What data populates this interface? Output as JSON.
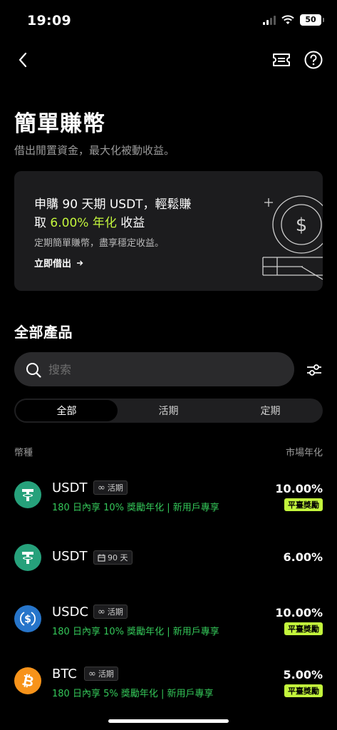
{
  "status": {
    "time": "19:09",
    "battery": "50"
  },
  "page": {
    "title": "簡單賺幣",
    "subtitle": "借出閒置資金，最大化被動收益。"
  },
  "promo": {
    "line1": "申購 90 天期 USDT，輕鬆賺",
    "line2_prefix": "取 ",
    "line2_accent": "6.00% 年化",
    "line2_suffix": " 收益",
    "desc": "定期簡單賺幣，盡享穩定收益。",
    "link": "立即借出",
    "accent_color": "#c3f53c"
  },
  "section": {
    "title": "全部產品"
  },
  "search": {
    "placeholder": "搜索",
    "value": ""
  },
  "tabs": [
    {
      "label": "全部",
      "active": true
    },
    {
      "label": "活期",
      "active": false
    },
    {
      "label": "定期",
      "active": false
    }
  ],
  "columns": {
    "left": "幣種",
    "right": "市場年化"
  },
  "products": [
    {
      "coin": "USDT",
      "icon": "tether-icon",
      "icon_color": "#26a17b",
      "term_icon": "infinity-icon",
      "term": "活期",
      "promo": "180 日內享 10% 獎勵年化 | 新用戶專享",
      "rate": "10.00%",
      "badge": "平臺獎勵"
    },
    {
      "coin": "USDT",
      "icon": "tether-icon",
      "icon_color": "#26a17b",
      "term_icon": "calendar-icon",
      "term": "90 天",
      "promo": "",
      "rate": "6.00%",
      "badge": ""
    },
    {
      "coin": "USDC",
      "icon": "usdc-icon",
      "icon_color": "#2775ca",
      "term_icon": "infinity-icon",
      "term": "活期",
      "promo": "180 日內享 10% 獎勵年化 | 新用戶專享",
      "rate": "10.00%",
      "badge": "平臺獎勵"
    },
    {
      "coin": "BTC",
      "icon": "bitcoin-icon",
      "icon_color": "#f7931a",
      "term_icon": "infinity-icon",
      "term": "活期",
      "promo": "180 日內享 5% 獎勵年化 | 新用戶專享",
      "rate": "5.00%",
      "badge": "平臺獎勵"
    }
  ]
}
